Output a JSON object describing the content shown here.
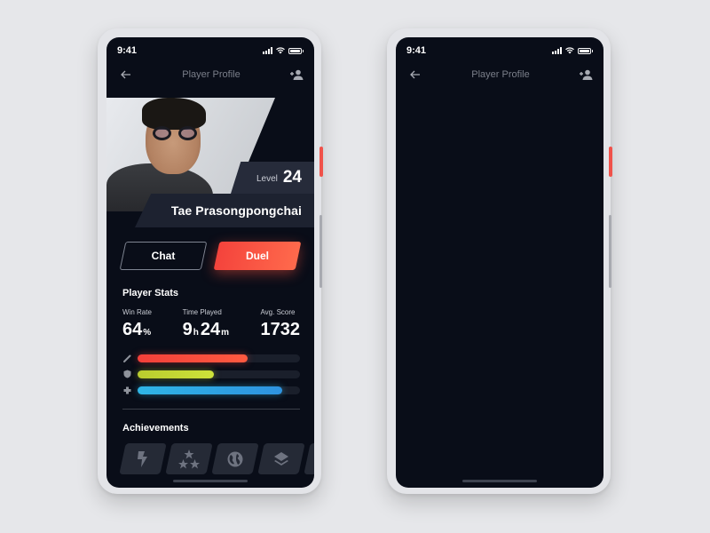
{
  "status_bar": {
    "time": "9:41"
  },
  "nav": {
    "title": "Player Profile",
    "back_icon": "arrow-left-icon",
    "action_icon": "add-user-icon"
  },
  "profile": {
    "level_label": "Level",
    "level_value": "24",
    "name": "Tae Prasongpongchai"
  },
  "actions": {
    "chat_label": "Chat",
    "duel_label": "Duel"
  },
  "stats": {
    "title": "Player Stats",
    "win_rate": {
      "label": "Win Rate",
      "value": "64",
      "unit": "%"
    },
    "time_played": {
      "label": "Time Played",
      "hours": "9",
      "hours_unit": "h",
      "minutes": "24",
      "minutes_unit": "m"
    },
    "avg_score": {
      "label": "Avg. Score",
      "value": "1732"
    },
    "bars": [
      {
        "icon": "sword-icon",
        "percent": 68,
        "color_start": "#f3403a",
        "color_end": "#ff5a40"
      },
      {
        "icon": "shield-icon",
        "percent": 47,
        "color_start": "#b9cc2e",
        "color_end": "#cde23a"
      },
      {
        "icon": "health-cross-icon",
        "percent": 89,
        "color_start": "#2fb6e6",
        "color_end": "#2e93e0"
      }
    ]
  },
  "achievements": {
    "title": "Achievements",
    "items": [
      "lightning-icon",
      "stars-icon",
      "globe-icon",
      "layers-icon"
    ]
  },
  "colors": {
    "screen_bg": "#090d18",
    "accent_red": "#f4433c",
    "page_bg": "#e6e7ea"
  },
  "right_phone": {
    "status_time": "9:41",
    "nav_title": "Player Profile"
  }
}
